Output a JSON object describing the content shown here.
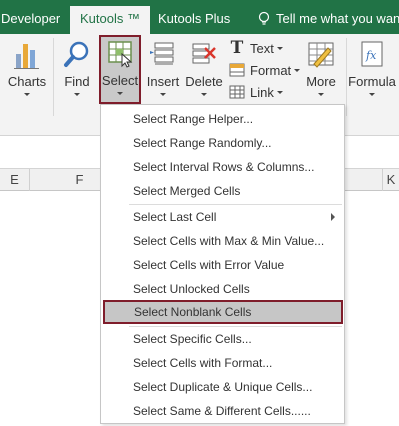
{
  "tabs": {
    "developer": "Developer",
    "kutools": "Kutools ™",
    "kutools_plus": "Kutools Plus",
    "tell_me": "Tell me what you want t"
  },
  "ribbon": {
    "charts": "Charts",
    "find": "Find",
    "select": "Select",
    "insert": "Insert",
    "delete": "Delete",
    "text": "Text",
    "format": "Format",
    "link": "Link",
    "more": "More",
    "formula": "Formula"
  },
  "columns": [
    "E",
    "F",
    "K"
  ],
  "menu": {
    "items": [
      "Select Range Helper...",
      "Select Range Randomly...",
      "Select Interval Rows & Columns...",
      "Select Merged Cells",
      "Select Last Cell",
      "Select Cells with Max & Min Value...",
      "Select Cells with Error Value",
      "Select Unlocked Cells",
      "Select Nonblank Cells",
      "Select Specific Cells...",
      "Select Cells with Format...",
      "Select Duplicate & Unique Cells...",
      "Select Same & Different Cells......"
    ]
  },
  "colors": {
    "excel_green": "#217346",
    "highlight_border": "#7f1d2b",
    "highlight_fill": "#c6c6c6"
  }
}
